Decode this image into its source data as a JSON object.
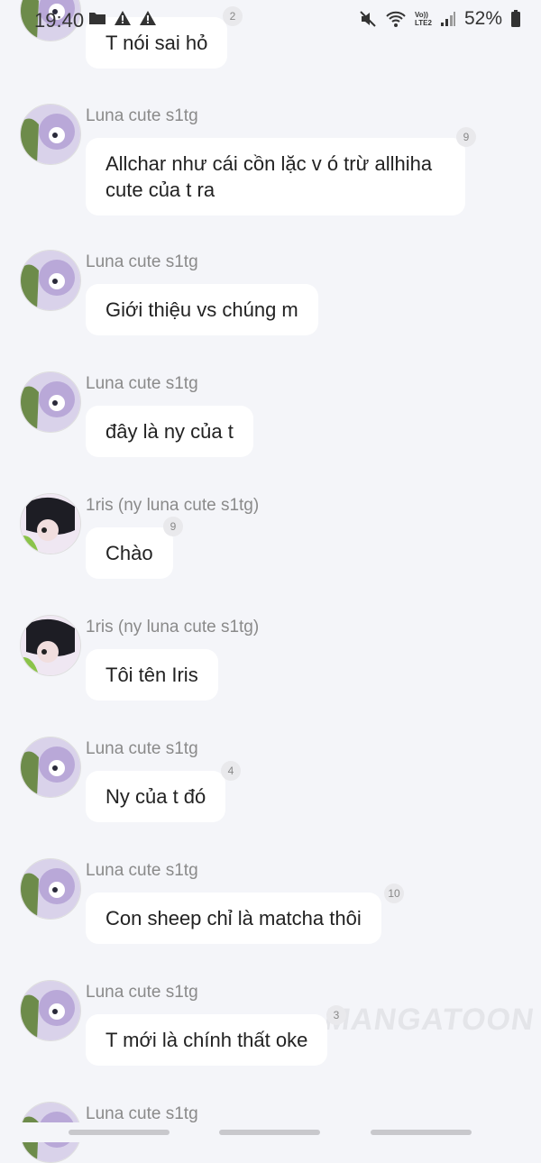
{
  "status_bar": {
    "time": "19:40",
    "battery": "52%",
    "left_icons": [
      "folder-icon",
      "warning-icon",
      "warning-icon"
    ],
    "right_icons": [
      "mute-icon",
      "wifi-icon",
      "volte-icon",
      "signal-icon",
      "battery-icon"
    ],
    "volte_top": "Vo))",
    "volte_bottom": "LTE2"
  },
  "messages": [
    {
      "user": "",
      "text": "T nói sai hỏ",
      "badge": "2"
    },
    {
      "user": "Luna cute s1tg",
      "text": "Allchar như cái cồn lặc v ó trừ allhiha cute của t ra",
      "badge": "9"
    },
    {
      "user": "Luna cute s1tg",
      "text": "Giới thiệu vs chúng m",
      "badge": ""
    },
    {
      "user": "Luna cute s1tg",
      "text": "đây là ny của t",
      "badge": ""
    },
    {
      "user": "1ris (ny luna cute s1tg)",
      "text": "Chào",
      "badge": "9"
    },
    {
      "user": "1ris (ny luna cute s1tg)",
      "text": "Tôi tên Iris",
      "badge": ""
    },
    {
      "user": "Luna cute s1tg",
      "text": "Ny của t đó",
      "badge": "4"
    },
    {
      "user": "Luna cute s1tg",
      "text": "Con sheep chỉ là matcha thôi",
      "badge": "10"
    },
    {
      "user": "Luna cute s1tg",
      "text": "T mới là chính thất oke",
      "badge": "3"
    },
    {
      "user": "Luna cute s1tg",
      "text": "",
      "badge": ""
    }
  ],
  "watermark": "MANGATOON"
}
